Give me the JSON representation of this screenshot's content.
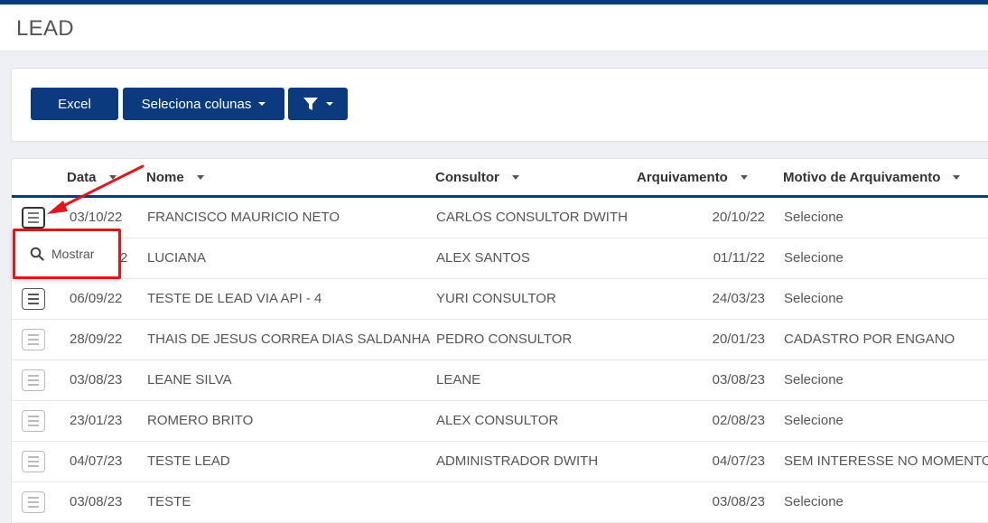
{
  "page": {
    "title": "LEAD"
  },
  "toolbar": {
    "excel_label": "Excel",
    "columns_label": "Seleciona colunas"
  },
  "table": {
    "headers": {
      "data": "Data",
      "nome": "Nome",
      "consultor": "Consultor",
      "arquivamento": "Arquivamento",
      "motivo": "Motivo de Arquivamento"
    },
    "rows": [
      {
        "data": "03/10/22",
        "nome": "FRANCISCO MAURICIO NETO",
        "consultor": "CARLOS CONSULTOR DWITH",
        "arquivamento": "20/10/22",
        "motivo": "Selecione"
      },
      {
        "data": "2",
        "nome": "LUCIANA",
        "consultor": "ALEX SANTOS",
        "arquivamento": "01/11/22",
        "motivo": "Selecione"
      },
      {
        "data": "06/09/22",
        "nome": "TESTE DE LEAD VIA API - 4",
        "consultor": "YURI CONSULTOR",
        "arquivamento": "24/03/23",
        "motivo": "Selecione"
      },
      {
        "data": "28/09/22",
        "nome": "THAIS DE JESUS CORREA DIAS SALDANHA",
        "consultor": "PEDRO CONSULTOR",
        "arquivamento": "20/01/23",
        "motivo": "CADASTRO POR ENGANO"
      },
      {
        "data": "03/08/23",
        "nome": "LEANE SILVA",
        "consultor": "LEANE",
        "arquivamento": "03/08/23",
        "motivo": "Selecione"
      },
      {
        "data": "23/01/23",
        "nome": "ROMERO BRITO",
        "consultor": "ALEX CONSULTOR",
        "arquivamento": "02/08/23",
        "motivo": "Selecione"
      },
      {
        "data": "04/07/23",
        "nome": "TESTE LEAD",
        "consultor": "ADMINISTRADOR DWITH",
        "arquivamento": "04/07/23",
        "motivo": "SEM INTERESSE NO MOMENTO"
      },
      {
        "data": "03/08/23",
        "nome": "TESTE",
        "consultor": "",
        "arquivamento": "03/08/23",
        "motivo": "Selecione"
      }
    ]
  },
  "row_menu": {
    "show_label": "Mostrar"
  },
  "colors": {
    "primary": "#0b3a7e",
    "highlight": "#e4141b"
  },
  "icons": [
    "filter-icon",
    "caret-down-icon",
    "sort-icon",
    "row-menu-icon",
    "search-icon"
  ]
}
